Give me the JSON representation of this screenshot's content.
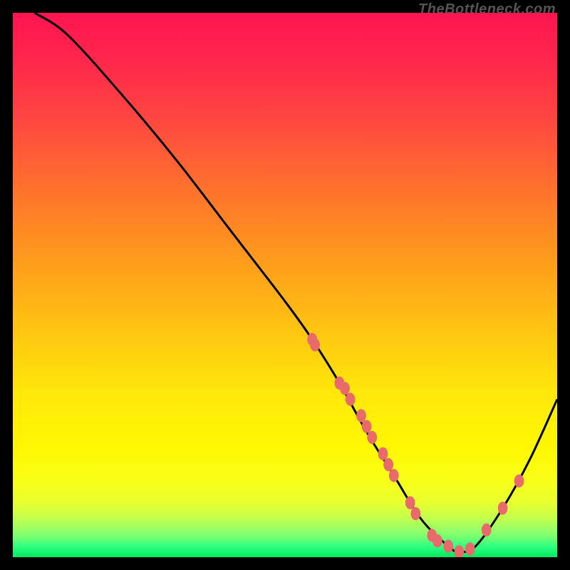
{
  "watermark": "TheBottleneck.com",
  "chart_data": {
    "type": "line",
    "title": "",
    "xlabel": "",
    "ylabel": "",
    "xlim": [
      0,
      100
    ],
    "ylim": [
      0,
      100
    ],
    "grid": false,
    "legend": false,
    "background": "rainbow-gradient (red → yellow → green, top → bottom)",
    "curve": {
      "description": "Smooth V-shaped curve descending steeply from upper-left to a minimum near x≈82 then rising toward the right edge",
      "points_xy": [
        [
          4,
          100
        ],
        [
          10,
          96
        ],
        [
          20,
          85
        ],
        [
          30,
          73
        ],
        [
          40,
          60
        ],
        [
          50,
          47
        ],
        [
          55,
          40
        ],
        [
          60,
          32
        ],
        [
          65,
          23
        ],
        [
          70,
          15
        ],
        [
          75,
          7
        ],
        [
          80,
          2
        ],
        [
          82,
          1
        ],
        [
          85,
          2
        ],
        [
          90,
          9
        ],
        [
          95,
          18
        ],
        [
          100,
          29
        ]
      ]
    },
    "markers": {
      "description": "Salmon dots along the curve concentrated on the descent (x≈55–80) and a few on the ascent (x≈87–93)",
      "points_xy": [
        [
          55,
          40
        ],
        [
          55.5,
          39
        ],
        [
          60,
          32
        ],
        [
          61,
          31
        ],
        [
          62,
          29
        ],
        [
          64,
          26
        ],
        [
          65,
          24
        ],
        [
          66,
          22
        ],
        [
          68,
          19
        ],
        [
          69,
          17
        ],
        [
          70,
          15
        ],
        [
          73,
          10
        ],
        [
          74,
          8
        ],
        [
          77,
          4
        ],
        [
          78,
          3
        ],
        [
          80,
          2
        ],
        [
          82,
          1
        ],
        [
          84,
          1.5
        ],
        [
          87,
          5
        ],
        [
          90,
          9
        ],
        [
          93,
          14
        ]
      ]
    }
  }
}
